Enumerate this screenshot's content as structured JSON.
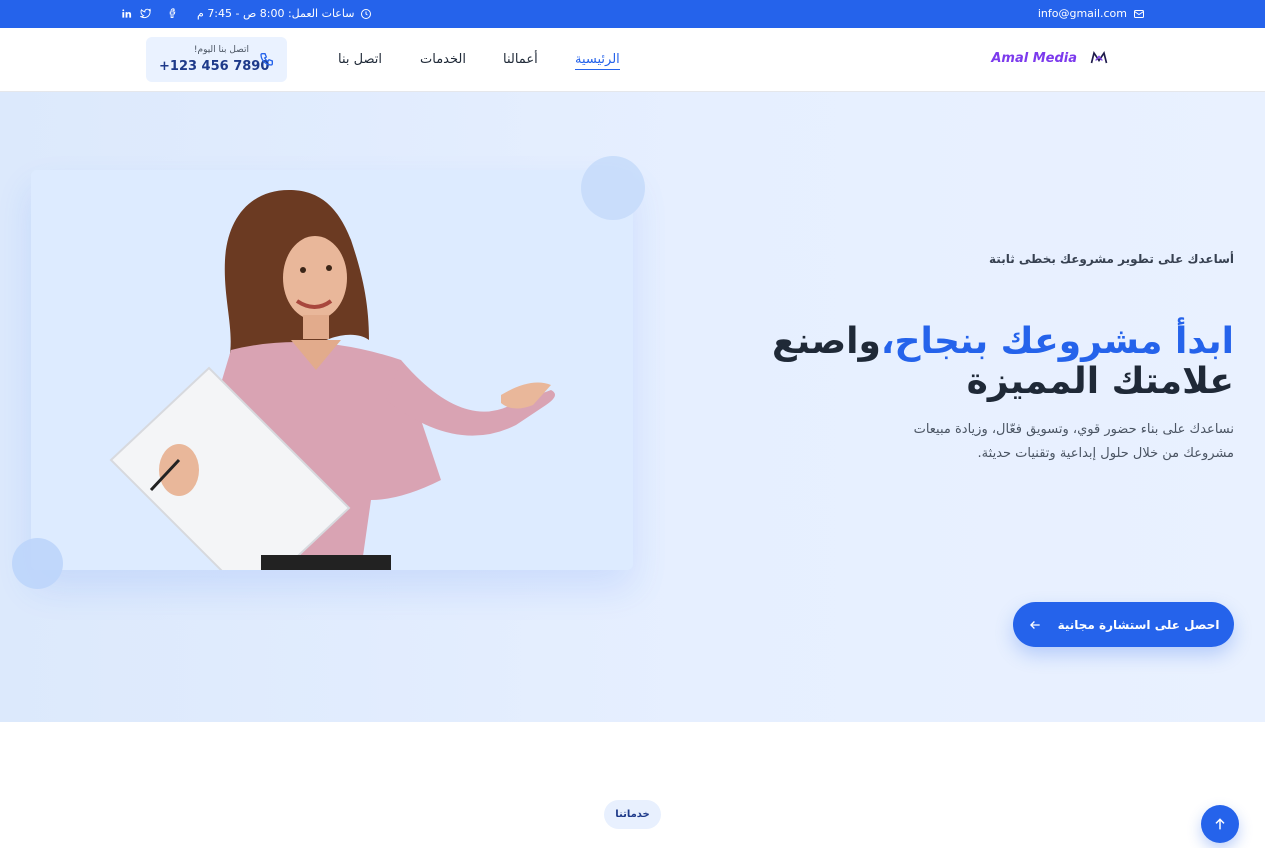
{
  "topbar": {
    "email": "info@gmail.com",
    "hours": "ساعات العمل: 8:00 ص - 7:45 م",
    "socials": [
      "facebook-icon",
      "twitter-icon",
      "linkedin-icon"
    ]
  },
  "header": {
    "brand": "Amal Media",
    "nav": [
      {
        "label": "الرئيسية",
        "active": true
      },
      {
        "label": "أعمالنا",
        "active": false
      },
      {
        "label": "الخدمات",
        "active": false
      },
      {
        "label": "اتصل بنا",
        "active": false
      }
    ],
    "call": {
      "caption": "اتصل بنا اليوم!",
      "phone": "+123 456 7890"
    }
  },
  "hero": {
    "kicker": "أساعدك على تطوير مشروعك بخطى ثابتة",
    "title_highlight": "ابدأ مشروعك بنجاح،",
    "title_rest": "واصنع علامتك المميزة",
    "lead": "نساعدك على بناء حضور قوي، وتسويق فعّال، وزيادة مبيعات مشروعك من خلال حلول إبداعية وتقنيات حديثة.",
    "cta": "احصل على استشارة مجانية"
  },
  "services": {
    "badge": "خدماتنا"
  },
  "colors": {
    "primary": "#2563eb",
    "brand": "#7c3aed",
    "hero_bg": "#e6efff"
  }
}
